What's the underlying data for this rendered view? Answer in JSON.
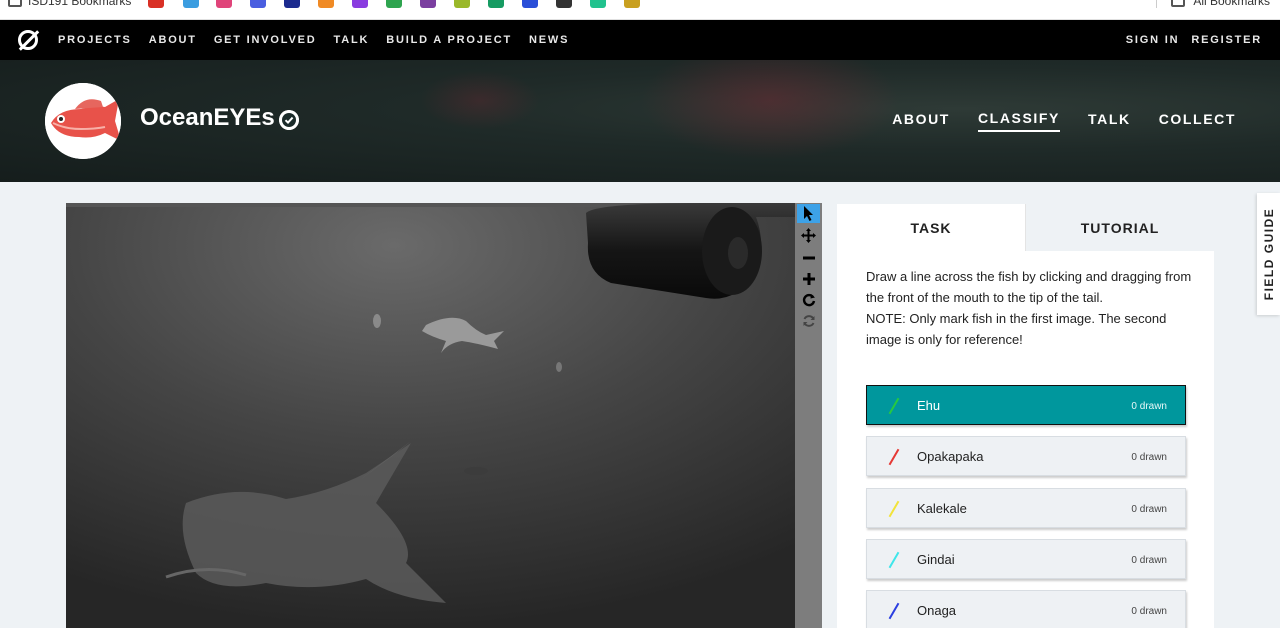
{
  "browser": {
    "bookmarks_folder": "ISD191 Bookmarks",
    "all_bookmarks": "All Bookmarks",
    "bookmark_icons": [
      {
        "name": "bookmark-red-icon",
        "color": "#d93025"
      },
      {
        "name": "bookmark-paypal-icon",
        "color": "#3b9de0"
      },
      {
        "name": "bookmark-pinwheel-icon",
        "color": "#e0447a"
      },
      {
        "name": "bookmark-c-icon",
        "color": "#4a5ee0"
      },
      {
        "name": "bookmark-kh-icon",
        "color": "#1c2b8f"
      },
      {
        "name": "bookmark-orange-icon",
        "color": "#f08a24"
      },
      {
        "name": "bookmark-k-icon",
        "color": "#8a3ce0"
      },
      {
        "name": "bookmark-green-icon",
        "color": "#2ea44f"
      },
      {
        "name": "bookmark-purple-icon",
        "color": "#7b3fa0"
      },
      {
        "name": "bookmark-lime-icon",
        "color": "#9ab82a"
      },
      {
        "name": "bookmark-teal-icon",
        "color": "#169b62"
      },
      {
        "name": "bookmark-blue-icon",
        "color": "#2b4fd8"
      },
      {
        "name": "bookmark-cl-icon",
        "color": "#333333"
      },
      {
        "name": "bookmark-mint-icon",
        "color": "#21c28e"
      },
      {
        "name": "bookmark-globe-icon",
        "color": "#c9a020"
      }
    ]
  },
  "topnav": {
    "links": [
      "PROJECTS",
      "ABOUT",
      "GET INVOLVED",
      "TALK",
      "BUILD A PROJECT",
      "NEWS"
    ],
    "sign_in": "SIGN IN",
    "register": "REGISTER"
  },
  "project": {
    "title": "OceanEYEs",
    "nav": [
      "ABOUT",
      "CLASSIFY",
      "TALK",
      "COLLECT"
    ],
    "active_nav": "CLASSIFY"
  },
  "task": {
    "tabs": [
      "TASK",
      "TUTORIAL"
    ],
    "active_tab": "TASK",
    "instruction_1": "Draw a line across the fish by clicking and dragging from the front of the mouth to the tip of the tail.",
    "instruction_2": "NOTE: Only mark fish in the first image. The second image is only for reference!",
    "tools": [
      {
        "label": "Ehu",
        "count": "0 drawn",
        "color": "#27c93f",
        "selected": true
      },
      {
        "label": "Opakapaka",
        "count": "0 drawn",
        "color": "#e53935",
        "selected": false
      },
      {
        "label": "Kalekale",
        "count": "0 drawn",
        "color": "#f2e33a",
        "selected": false
      },
      {
        "label": "Gindai",
        "count": "0 drawn",
        "color": "#3fe6ea",
        "selected": false
      },
      {
        "label": "Onaga",
        "count": "0 drawn",
        "color": "#2b3fe0",
        "selected": false
      }
    ]
  },
  "field_guide": "FIELD GUIDE",
  "colors": {
    "accent_teal": "#00979d",
    "toolbar_active": "#3da2e8",
    "nav_bg": "#000000",
    "page_bg": "#eef2f5"
  }
}
